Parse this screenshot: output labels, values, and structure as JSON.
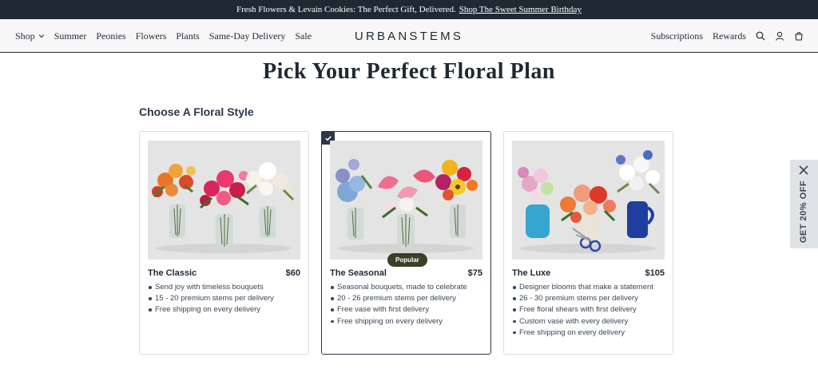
{
  "announcement": {
    "text": "Fresh Flowers & Levain Cookies: The Perfect Gift, Delivered.",
    "link": "Shop The Sweet Summer Birthday"
  },
  "nav": {
    "left": [
      "Shop",
      "Summer",
      "Peonies",
      "Flowers",
      "Plants",
      "Same-Day Delivery",
      "Sale"
    ],
    "logo": "URBANSTEMS",
    "right": [
      "Subscriptions",
      "Rewards"
    ],
    "icons": [
      "search-icon",
      "account-icon",
      "cart-icon"
    ]
  },
  "main": {
    "title": "Pick Your Perfect Floral Plan",
    "section_title": "Choose A Floral Style",
    "cards": [
      {
        "name": "The Classic",
        "price": "$60",
        "features": [
          "Send joy with timeless bouquets",
          "15 - 20 premium stems per delivery",
          "Free shipping on every delivery"
        ]
      },
      {
        "name": "The Seasonal",
        "price": "$75",
        "badge": "Popular",
        "selected": true,
        "features": [
          "Seasonal bouquets, made to celebrate",
          "20 - 26 premium stems per delivery",
          "Free vase with first delivery",
          "Free shipping on every delivery"
        ]
      },
      {
        "name": "The Luxe",
        "price": "$105",
        "features": [
          "Designer blooms that make a statement",
          "26 - 30 premium stems per delivery",
          "Free floral shears with first delivery",
          "Custom vase with every delivery",
          "Free shipping on every delivery"
        ]
      }
    ]
  },
  "side_tab": {
    "label": "GET 20% OFF"
  },
  "colors": {
    "dark": "#1f2933",
    "badge": "#3a3f25",
    "photo_bg": "#e4e4e4",
    "side_tab_bg": "#dfe3e6"
  }
}
